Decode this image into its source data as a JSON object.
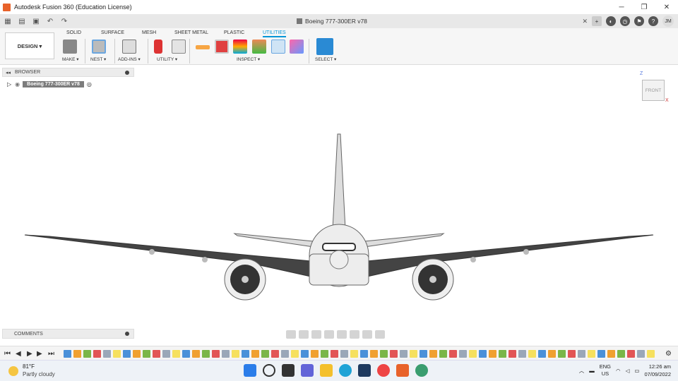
{
  "window": {
    "title": "Autodesk Fusion 360 (Education License)",
    "minimize": "─",
    "maximize": "❐",
    "close": "✕"
  },
  "doc_tab": {
    "title": "Boeing 777-300ER v78",
    "close": "✕"
  },
  "user": {
    "initials": "JM"
  },
  "ribbon": {
    "workspace": "DESIGN ▾",
    "tabs": [
      "SOLID",
      "SURFACE",
      "MESH",
      "SHEET METAL",
      "PLASTIC",
      "UTILITIES"
    ],
    "active_tab": "UTILITIES",
    "groups": [
      "MAKE ▾",
      "NEST ▾",
      "ADD-INS ▾",
      "UTILITY ▾",
      "INSPECT ▾",
      "SELECT ▾"
    ]
  },
  "browser": {
    "label": "BROWSER",
    "root_item": "Boeing 777-300ER v78"
  },
  "viewcube": {
    "face": "FRONT",
    "axis_z": "Z",
    "axis_x": "X"
  },
  "comments": {
    "label": "COMMENTS"
  },
  "taskbar": {
    "weather_temp": "81°F",
    "weather_desc": "Partly cloudy",
    "lang_top": "ENG",
    "lang_bottom": "US",
    "time": "12:26 am",
    "date": "07/09/2022"
  },
  "colors": {
    "accent": "#0696d7",
    "brand": "#e8622a"
  }
}
